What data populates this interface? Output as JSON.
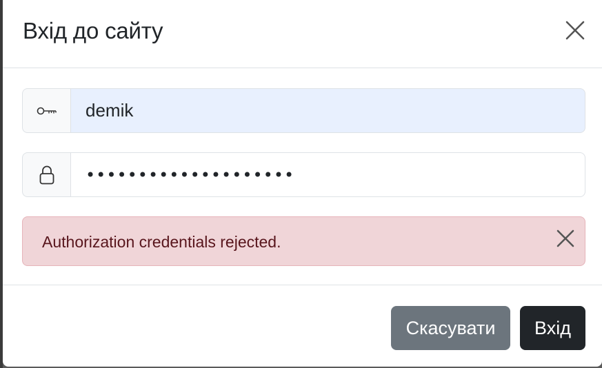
{
  "dialog": {
    "title": "Вхід до сайту",
    "close_icon": "close-icon"
  },
  "form": {
    "username": {
      "icon": "key-icon",
      "value": "demik"
    },
    "password": {
      "icon": "lock-icon",
      "value": "••••••••••••••••••••"
    }
  },
  "alert": {
    "message": "Authorization credentials rejected.",
    "close_icon": "close-icon",
    "color": "#f0d5d8"
  },
  "footer": {
    "cancel_label": "Скасувати",
    "login_label": "Вхід"
  },
  "colors": {
    "autofill_bg": "#e8f0fe",
    "cancel_bg": "#6c757d",
    "login_bg": "#212529"
  }
}
